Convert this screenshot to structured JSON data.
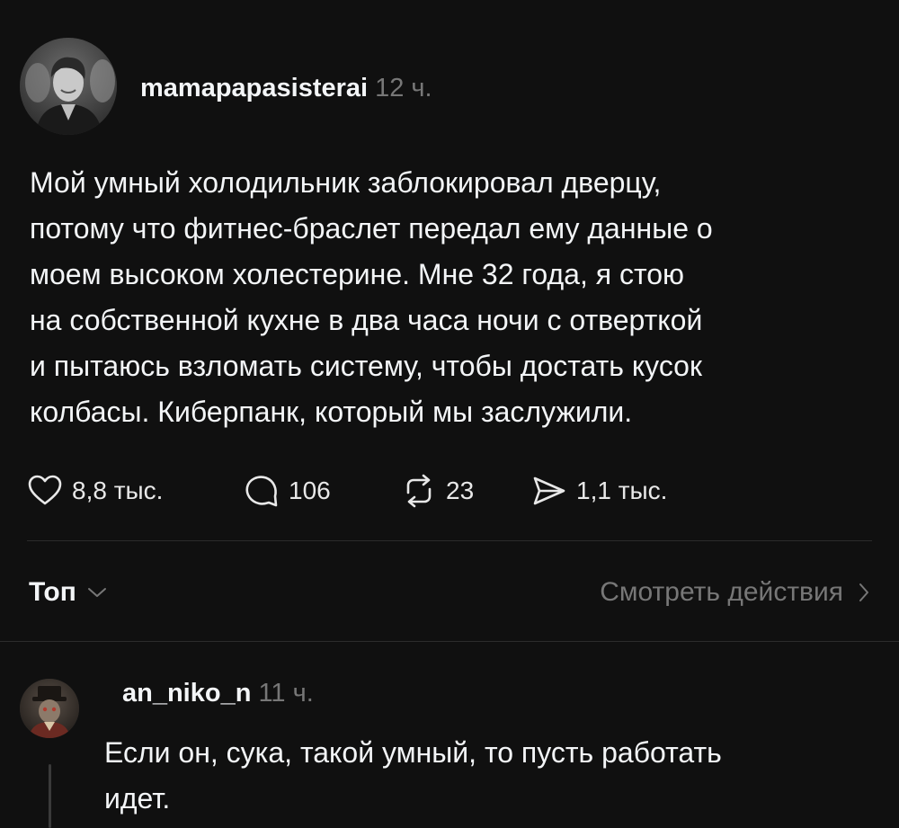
{
  "post": {
    "username": "mamapapasisterai",
    "time": "12 ч.",
    "text": "Мой умный холодильник заблокировал дверцу,\nпотому что фитнес-браслет передал ему данные о\nмоем высоком холестерине. Мне 32 года, я стою\nна собственной кухне в два часа ночи с отверткой\nи пытаюсь взломать систему, чтобы достать кусок\nколбасы. Киберпанк, который мы заслужили.",
    "actions": {
      "likes": "8,8 тыс.",
      "replies": "106",
      "reposts": "23",
      "shares": "1,1 тыс."
    }
  },
  "sort": {
    "label": "Топ",
    "view_activity": "Смотреть действия"
  },
  "reply": {
    "username": "an_niko_n",
    "time": "11 ч.",
    "text": "Если он, сука, такой умный, то пусть работать\nидет."
  },
  "icons": {
    "like": "heart-icon",
    "reply": "speech-bubble-icon",
    "repost": "repost-arrows-icon",
    "share": "paper-plane-icon",
    "sort": "chevron-down-icon",
    "view": "chevron-right-icon"
  },
  "colors": {
    "background": "#101010",
    "text": "#f3f5f7",
    "muted": "#777777",
    "divider": "#2c2c2c"
  }
}
